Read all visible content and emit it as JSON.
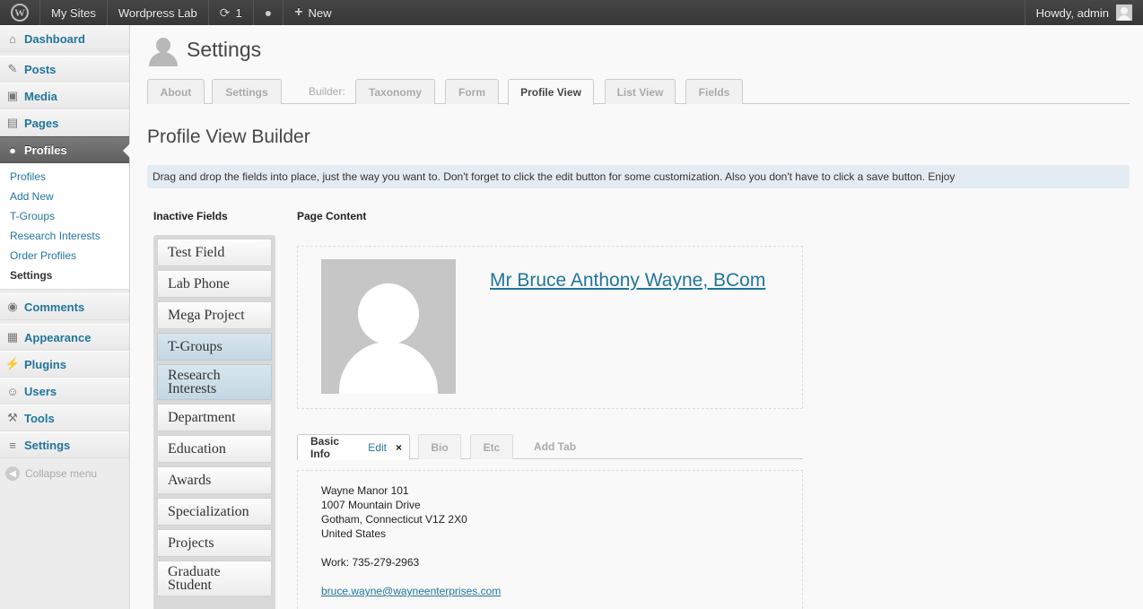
{
  "adminbar": {
    "sites": "My Sites",
    "site_name": "Wordpress Lab",
    "updates_count": "1",
    "new_label": "New",
    "howdy": "Howdy, admin"
  },
  "sidebar": {
    "items": [
      {
        "label": "Dashboard",
        "icon": "dashboard-icon"
      },
      {
        "label": "Posts",
        "icon": "pin-icon"
      },
      {
        "label": "Media",
        "icon": "media-icon"
      },
      {
        "label": "Pages",
        "icon": "pages-icon"
      },
      {
        "label": "Profiles",
        "icon": "person-icon"
      },
      {
        "label": "Comments",
        "icon": "comment-icon"
      },
      {
        "label": "Appearance",
        "icon": "appearance-icon"
      },
      {
        "label": "Plugins",
        "icon": "plugin-icon"
      },
      {
        "label": "Users",
        "icon": "users-icon"
      },
      {
        "label": "Tools",
        "icon": "tools-icon"
      },
      {
        "label": "Settings",
        "icon": "settings-icon"
      }
    ],
    "submenu": [
      "Profiles",
      "Add New",
      "T-Groups",
      "Research Interests",
      "Order Profiles",
      "Settings"
    ],
    "collapse": "Collapse menu"
  },
  "page": {
    "title": "Settings",
    "tabs": [
      "About",
      "Settings",
      "Taxonomy",
      "Form",
      "Profile View",
      "List View",
      "Fields"
    ],
    "builder_label": "Builder:",
    "builder_title": "Profile View Builder",
    "notice": "Drag and drop the fields into place, just the way you want to. Don't forget to click the edit button for some customization. Also you don't have to click a save button. Enjoy"
  },
  "inactive": {
    "title": "Inactive Fields",
    "fields": [
      "Test Field",
      "Lab Phone",
      "Mega Project",
      "T-Groups",
      "Research Interests",
      "Department",
      "Education",
      "Awards",
      "Specialization",
      "Projects",
      "Graduate Student"
    ]
  },
  "content": {
    "title": "Page Content",
    "name": "Mr Bruce Anthony Wayne, BCom",
    "tabs": {
      "active": "Basic Info",
      "edit": "Edit",
      "close": "×",
      "bio": "Bio",
      "etc": "Etc",
      "add": "Add Tab"
    },
    "address": [
      "Wayne Manor 101",
      "1007 Mountain Drive",
      "Gotham, Connecticut V1Z 2X0",
      "United States"
    ],
    "work": "Work: 735-279-2963",
    "email": "bruce.wayne@wayneenterprises.com"
  }
}
